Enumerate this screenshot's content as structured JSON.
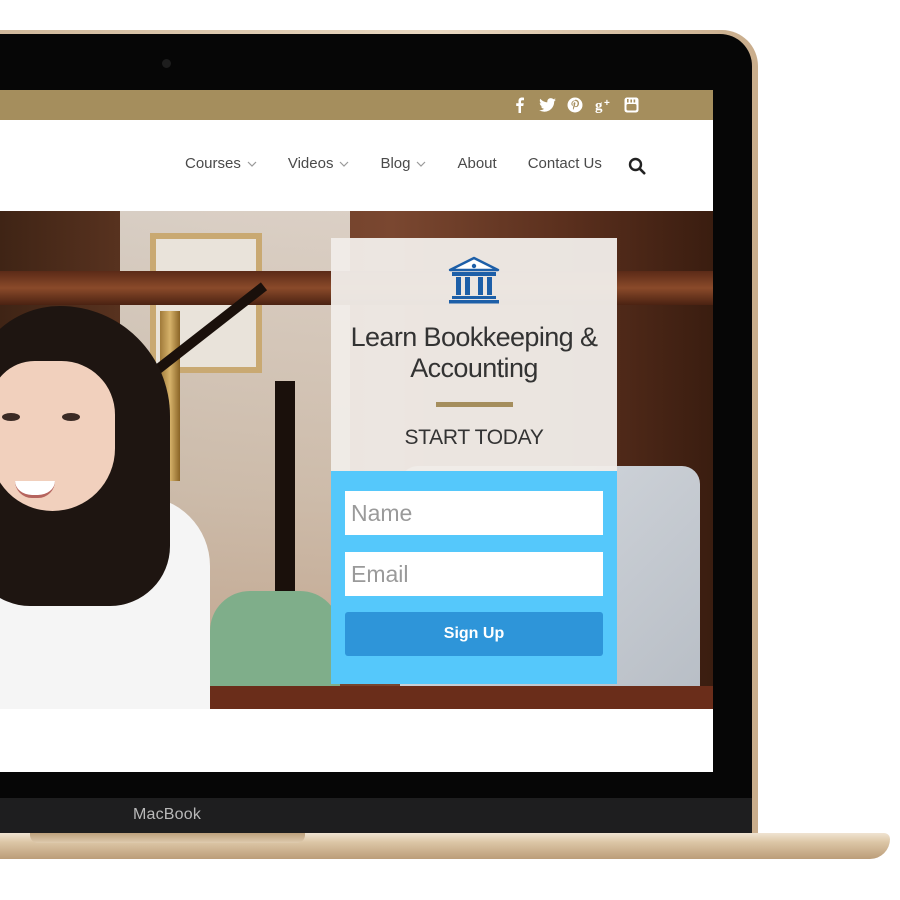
{
  "social": [
    "facebook-icon",
    "twitter-icon",
    "pinterest-icon",
    "google-plus-icon",
    "youtube-icon"
  ],
  "nav": {
    "items": [
      {
        "label": "Courses",
        "dropdown": true
      },
      {
        "label": "Videos",
        "dropdown": true
      },
      {
        "label": "Blog",
        "dropdown": true
      },
      {
        "label": "About",
        "dropdown": false
      },
      {
        "label": "Contact Us",
        "dropdown": false
      }
    ],
    "search_icon": "search-icon"
  },
  "signup": {
    "icon": "bank-building-icon",
    "title_line1": "Learn Bookkeeping &",
    "title_line2": "Accounting",
    "subtitle": "START TODAY",
    "name_placeholder": "Name",
    "email_placeholder": "Email",
    "button_label": "Sign Up"
  },
  "device": {
    "label": "MacBook"
  },
  "colors": {
    "topbar": "#a58e5d",
    "accent_rule": "#a58e5d",
    "form_background": "#55c8fb",
    "button": "#2e95d9",
    "icon_blue": "#1d5fa8"
  }
}
